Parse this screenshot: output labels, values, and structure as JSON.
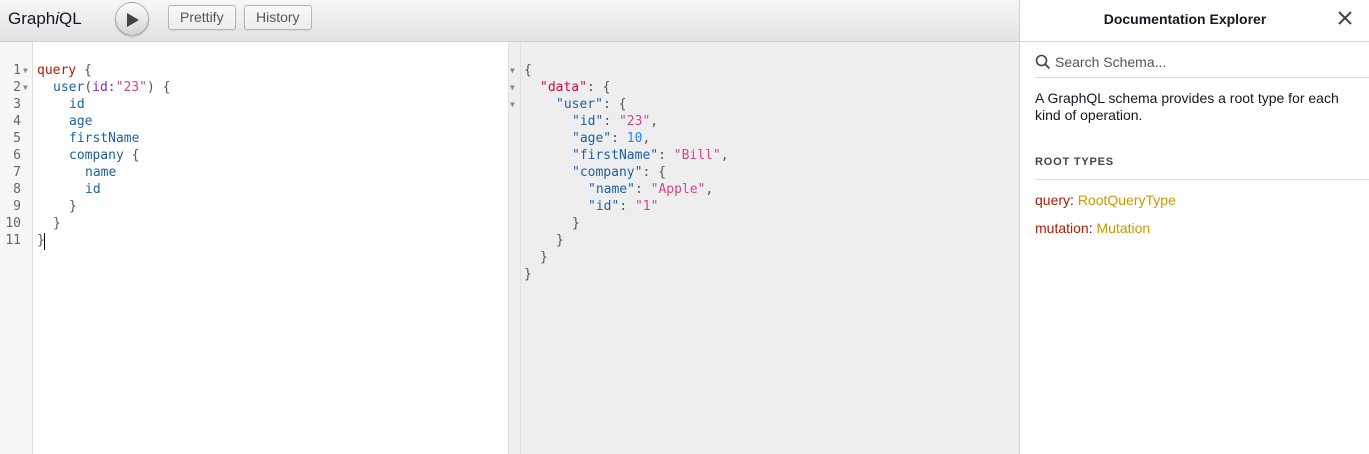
{
  "toolbar": {
    "logo_prefix": "Graph",
    "logo_italic": "i",
    "logo_suffix": "QL",
    "execute_icon": "play-icon",
    "prettify_label": "Prettify",
    "history_label": "History"
  },
  "query_editor": {
    "line_numbers": [
      "1",
      "2",
      "3",
      "4",
      "5",
      "6",
      "7",
      "8",
      "9",
      "10",
      "11"
    ],
    "lines": {
      "l1": {
        "kw": "query",
        "brace": " {"
      },
      "l2": {
        "name": "user",
        "open": "(",
        "arg": "id",
        "colon": ":",
        "val": "\"23\"",
        "close": ") {"
      },
      "l3": {
        "field": "id"
      },
      "l4": {
        "field": "age"
      },
      "l5": {
        "field": "firstName"
      },
      "l6": {
        "field": "company",
        "brace": " {"
      },
      "l7": {
        "field": "name"
      },
      "l8": {
        "field": "id"
      },
      "l9": {
        "brace": "}"
      },
      "l10": {
        "brace": "}"
      },
      "l11": {
        "brace": "}"
      }
    }
  },
  "result_viewer": {
    "l1": "{",
    "l2": {
      "key": "\"data\"",
      "rest": ": {"
    },
    "l3": {
      "key": "\"user\"",
      "rest": ": {"
    },
    "l4": {
      "key": "\"id\"",
      "colon": ": ",
      "val": "\"23\"",
      "comma": ","
    },
    "l5": {
      "key": "\"age\"",
      "colon": ": ",
      "val": "10",
      "comma": ","
    },
    "l6": {
      "key": "\"firstName\"",
      "colon": ": ",
      "val": "\"Bill\"",
      "comma": ","
    },
    "l7": {
      "key": "\"company\"",
      "rest": ": {"
    },
    "l8": {
      "key": "\"name\"",
      "colon": ": ",
      "val": "\"Apple\"",
      "comma": ","
    },
    "l9": {
      "key": "\"id\"",
      "colon": ": ",
      "val": "\"1\""
    },
    "l10": "}",
    "l11": "}",
    "l12": "}",
    "l13": "}"
  },
  "docs": {
    "title": "Documentation Explorer",
    "close_icon": "close-icon",
    "search_placeholder": "Search Schema...",
    "description": "A GraphQL schema provides a root type for each kind of operation.",
    "root_types_label": "ROOT TYPES",
    "root_types": [
      {
        "field": "query",
        "sep": ": ",
        "type": "RootQueryType"
      },
      {
        "field": "mutation",
        "sep": ": ",
        "type": "Mutation"
      }
    ]
  },
  "colors": {
    "keyword": "#b11a04",
    "property": "#1f61a0",
    "string": "#d64292",
    "number": "#2882f9",
    "type_link": "#ca9800"
  }
}
